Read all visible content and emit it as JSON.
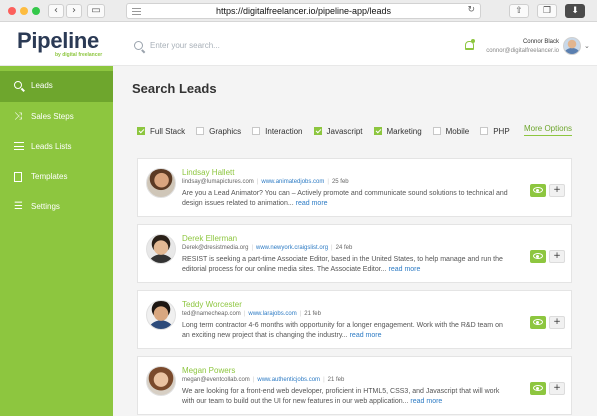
{
  "browser": {
    "url": "https://digitalfreelancer.io/pipeline-app/leads",
    "back_icon": "‹",
    "forward_icon": "›",
    "reload_icon": "↻"
  },
  "header": {
    "logo": "Pipeline",
    "logo_sub": "by digital freelancer",
    "search_placeholder": "Enter your search...",
    "user_name": "Connor Black",
    "user_email": "connor@digitalfreelancer.io"
  },
  "sidebar": {
    "items": [
      {
        "label": "Leads",
        "icon": "search-icon",
        "active": true
      },
      {
        "label": "Sales Steps",
        "icon": "shuffle-icon",
        "active": false
      },
      {
        "label": "Leads Lists",
        "icon": "list-icon",
        "active": false
      },
      {
        "label": "Templates",
        "icon": "document-icon",
        "active": false
      },
      {
        "label": "Settings",
        "icon": "sliders-icon",
        "active": false
      }
    ]
  },
  "main": {
    "title": "Search Leads",
    "filters": [
      {
        "label": "Full Stack",
        "checked": true
      },
      {
        "label": "Graphics",
        "checked": false
      },
      {
        "label": "Interaction",
        "checked": false
      },
      {
        "label": "Javascript",
        "checked": true
      },
      {
        "label": "Marketing",
        "checked": true
      },
      {
        "label": "Mobile",
        "checked": false
      },
      {
        "label": "PHP",
        "checked": false
      }
    ],
    "more_options": "More Options",
    "leads": [
      {
        "name": "Lindsay Hallett",
        "email": "lindsay@lumapictures.com",
        "site": "www.animatedjobs.com",
        "date": "25 feb",
        "description": "Are you a Lead Animator? You can – Actively promote and communicate sound solutions to technical and design issues related to animation...",
        "read_more": "read more"
      },
      {
        "name": "Derek Ellerman",
        "email": "Derek@dresistmedia.org",
        "site": "www.newyork.craigslist.org",
        "date": "24 feb",
        "description": "RESIST is seeking a part-time Associate Editor, based in the United States, to help manage and run the editorial process for our online media sites. The Associate Editor...",
        "read_more": "read more"
      },
      {
        "name": "Teddy Worcester",
        "email": "ted@namecheap.com",
        "site": "www.larajobs.com",
        "date": "21 feb",
        "description": "Long term contractor 4-6 months with opportunity for a longer engagement. Work with the R&D team on an exciting new project that is changing the industry...",
        "read_more": "read more"
      },
      {
        "name": "Megan Powers",
        "email": "megan@eventcollab.com",
        "site": "www.authenticjobs.com",
        "date": "21 feb",
        "description": "We are looking for a front-end web developer, proficient in HTML5, CSS3, and Javascript that will work with our team to build out the UI for new features in our web application...",
        "read_more": "read more"
      }
    ]
  },
  "colors": {
    "accent": "#8dc63f",
    "accent_dark": "#6ea62d",
    "link": "#2d7bc4",
    "logo": "#2b3a55"
  }
}
